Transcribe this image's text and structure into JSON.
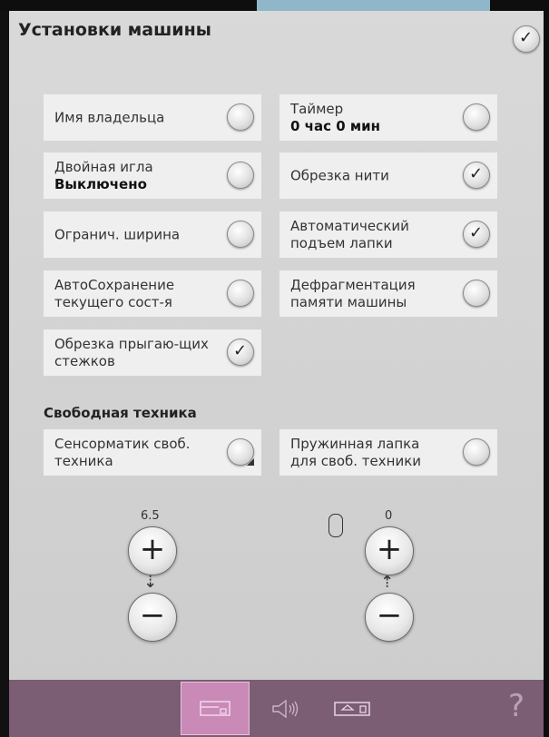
{
  "title": "Установки машины",
  "options": [
    {
      "label": "Имя владельца",
      "sub": "",
      "checked": false
    },
    {
      "label": "Таймер",
      "sub": "0 час 0 мин",
      "checked": false
    },
    {
      "label": "Двойная игла",
      "sub": "Выключено",
      "checked": false
    },
    {
      "label": "Обрезка нити",
      "sub": "",
      "checked": true
    },
    {
      "label": "Огранич. ширина",
      "sub": "",
      "checked": false
    },
    {
      "label": "Автоматический подъем лапки",
      "sub": "",
      "checked": true
    },
    {
      "label": "АвтоСохранение текущего сост-я",
      "sub": "",
      "checked": false
    },
    {
      "label": "Дефрагментация памяти машины",
      "sub": "",
      "checked": false
    },
    {
      "label": "Обрезка прыгаю-щих стежков",
      "sub": "",
      "checked": true
    }
  ],
  "freemotion": {
    "heading": "Свободная техника",
    "left": {
      "label": "Сенсорматик своб. техника",
      "checked": false
    },
    "right": {
      "label": "Пружинная лапка для своб. техники",
      "checked": false
    }
  },
  "left_control": {
    "value": "6.5",
    "plus": "+",
    "minus": "−"
  },
  "right_control": {
    "value": "0",
    "plus": "+",
    "minus": "−"
  },
  "bottom_bar": {
    "help": "?"
  },
  "icons": {
    "confirm": "checkmark-icon",
    "presser_foot_down": "presser-foot-height-icon",
    "presser_foot_up": "presser-foot-pressure-icon",
    "hoop": "hoop-icon",
    "nav_machine": "sewing-machine-settings-icon",
    "nav_sound": "sound-settings-icon",
    "nav_embroidery": "embroidery-machine-icon"
  }
}
